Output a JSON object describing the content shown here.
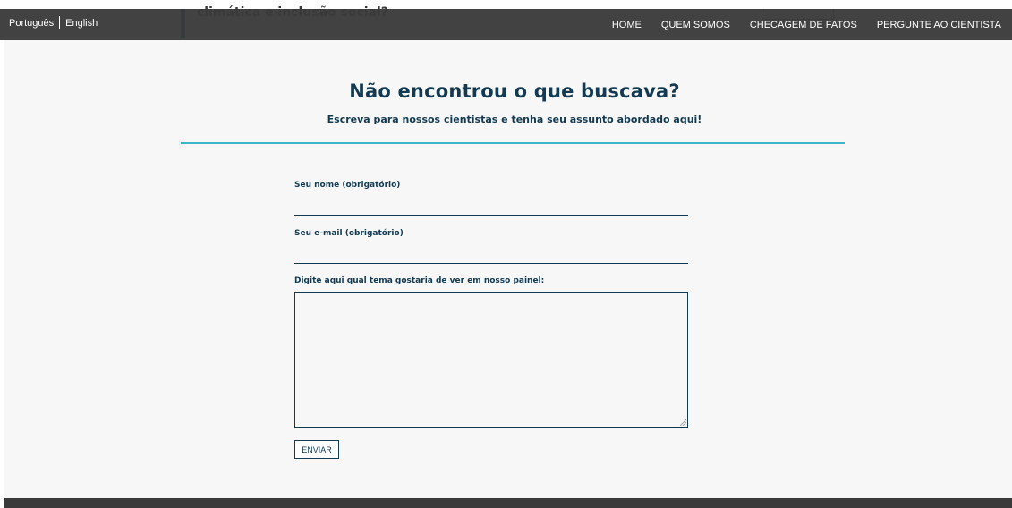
{
  "peek": {
    "text": "climática e inclusão social?"
  },
  "topbar": {
    "lang_pt": "Português",
    "lang_en": "English",
    "nav": [
      "HOME",
      "QUEM SOMOS",
      "CHECAGEM DE FATOS",
      "PERGUNTE AO CIENTISTA"
    ]
  },
  "heading": {
    "title": "Não encontrou o que buscava?",
    "subtitle": "Escreva para nossos cientistas e tenha seu assunto abordado aqui!"
  },
  "form": {
    "name_label": "Seu nome (obrigatório)",
    "name_value": "",
    "email_label": "Seu e-mail (obrigatório)",
    "email_value": "",
    "topic_label": "Digite aqui qual tema gostaria de ver em nosso painel:",
    "topic_value": "",
    "submit_label": "ENVIAR"
  },
  "colors": {
    "navy": "#123a52",
    "accent": "#3fb6c6",
    "bar": "#3a3a3a"
  }
}
